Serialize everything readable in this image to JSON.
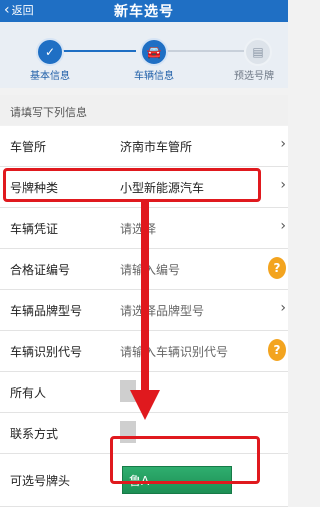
{
  "header": {
    "back_label": "返回",
    "title": "新车选号"
  },
  "steps": [
    {
      "label": "基本信息",
      "status": "done"
    },
    {
      "label": "车辆信息",
      "status": "active"
    },
    {
      "label": "预选号牌",
      "status": "pending"
    }
  ],
  "hint": "请填写下列信息",
  "rows": [
    {
      "label": "车管所",
      "value": "济南市车管所"
    },
    {
      "label": "号牌种类",
      "value": "小型新能源汽车"
    },
    {
      "label": "车辆凭证",
      "value": "请选择"
    },
    {
      "label": "合格证编号",
      "value": "请输入编号"
    },
    {
      "label": "车辆品牌型号",
      "value": "请选择品牌型号"
    },
    {
      "label": "车辆识别代号",
      "value": "请输入车辆识别代号"
    },
    {
      "label": "所有人",
      "value": ""
    },
    {
      "label": "联系方式",
      "value": ""
    },
    {
      "label": "可选号牌头",
      "value": "鲁A"
    }
  ],
  "colors": {
    "brand": "#1f6fc4",
    "highlight": "#e0191e",
    "plate": "#1d8f55",
    "help": "#f3a41f"
  },
  "icons": {
    "back": "chevron-left-icon",
    "step_done": "check-icon",
    "step_active": "car-icon",
    "step_pending": "plate-icon",
    "row_arrow": "chevron-right-icon",
    "help": "question-icon"
  }
}
